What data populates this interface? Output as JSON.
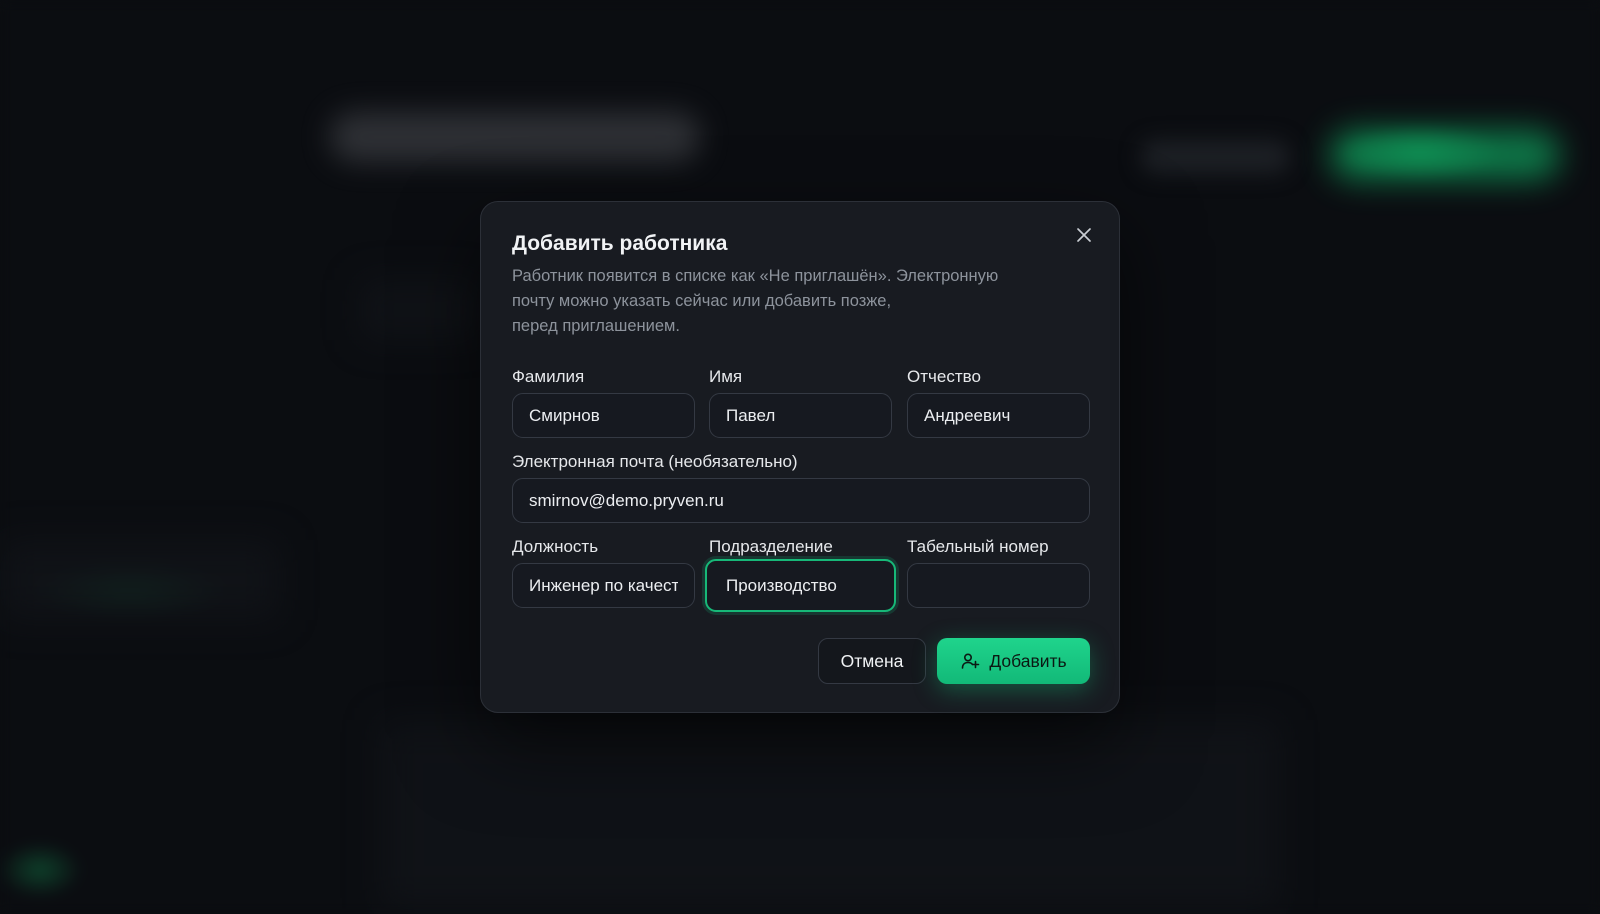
{
  "dialog": {
    "title": "Добавить работника",
    "description_lines": [
      "Работник появится в списке как «Не приглашён». Электронную",
      "почту можно указать сейчас или добавить позже,",
      "перед приглашением."
    ],
    "close_icon": "close-icon"
  },
  "form": {
    "last_name": {
      "label": "Фамилия",
      "value": "Смирнов"
    },
    "first_name": {
      "label": "Имя",
      "value": "Павел"
    },
    "middle_name": {
      "label": "Отчество",
      "value": "Андреевич"
    },
    "email": {
      "label": "Электронная почта (необязательно)",
      "value": "smirnov@demo.pryven.ru"
    },
    "position": {
      "label": "Должность",
      "value": "Инженер по качеству"
    },
    "department": {
      "label": "Подразделение",
      "value": "Производство"
    },
    "employee_number": {
      "label": "Табельный номер",
      "value": ""
    }
  },
  "actions": {
    "cancel_label": "Отмена",
    "add_label": "Добавить",
    "add_icon": "user-plus-icon"
  },
  "colors": {
    "accent": "#17b878",
    "background": "#0b0d11",
    "dialog_bg": "#181b21"
  }
}
